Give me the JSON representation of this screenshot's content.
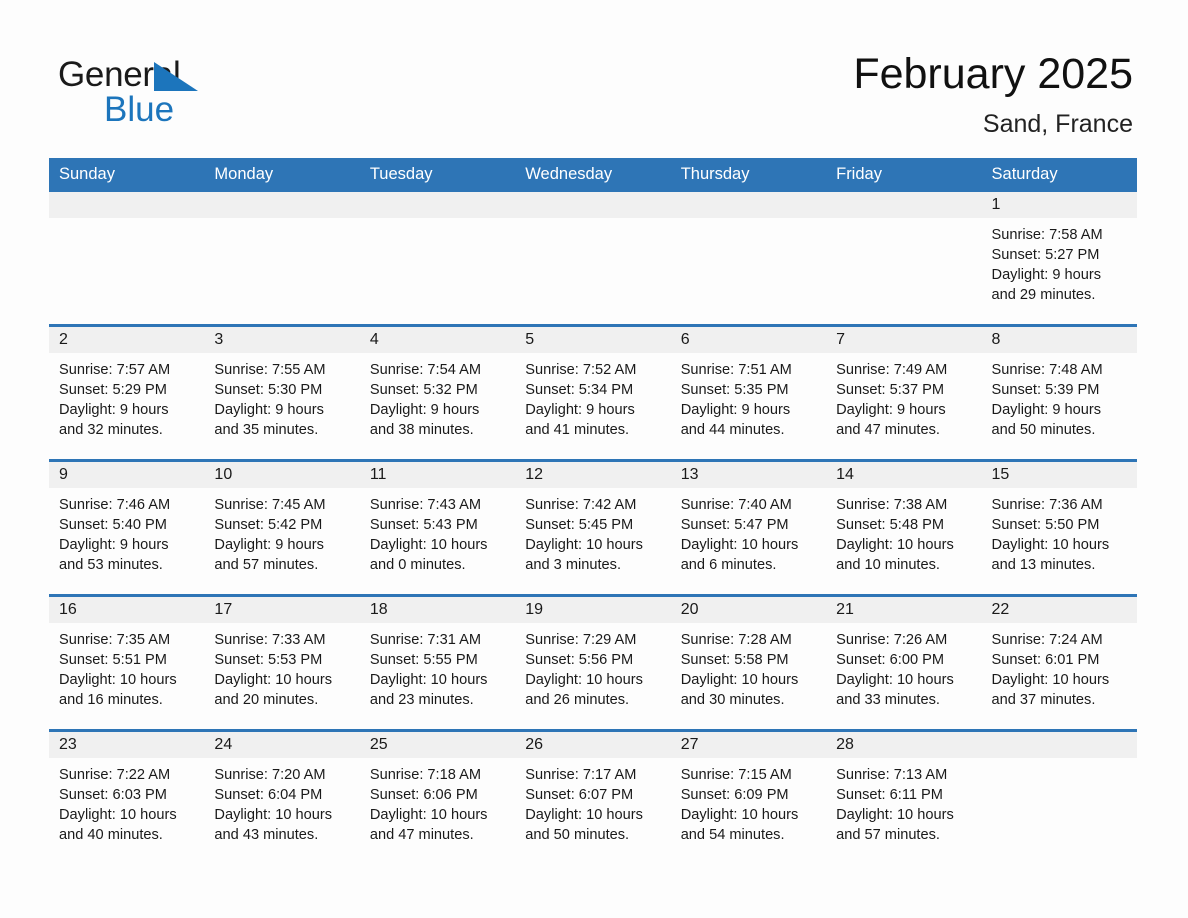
{
  "brand": {
    "name_part1": "General",
    "name_part2": "Blue",
    "logo_icon": "triangle-logo",
    "accent_color": "#1c75bc"
  },
  "header": {
    "title": "February 2025",
    "subtitle": "Sand, France"
  },
  "theme": {
    "header_blue": "#2e75b6",
    "cell_number_bg": "#f0f0f0",
    "page_bg": "#fdfdfd"
  },
  "weekday_headers": [
    "Sunday",
    "Monday",
    "Tuesday",
    "Wednesday",
    "Thursday",
    "Friday",
    "Saturday"
  ],
  "labels": {
    "sunrise_prefix": "Sunrise:",
    "sunset_prefix": "Sunset:",
    "daylight_prefix": "Daylight:"
  },
  "weeks": [
    [
      {
        "day": "",
        "empty": true
      },
      {
        "day": "",
        "empty": true
      },
      {
        "day": "",
        "empty": true
      },
      {
        "day": "",
        "empty": true
      },
      {
        "day": "",
        "empty": true
      },
      {
        "day": "",
        "empty": true
      },
      {
        "day": "1",
        "sunrise": "Sunrise: 7:58 AM",
        "sunset": "Sunset: 5:27 PM",
        "daylight1": "Daylight: 9 hours",
        "daylight2": "and 29 minutes."
      }
    ],
    [
      {
        "day": "2",
        "sunrise": "Sunrise: 7:57 AM",
        "sunset": "Sunset: 5:29 PM",
        "daylight1": "Daylight: 9 hours",
        "daylight2": "and 32 minutes."
      },
      {
        "day": "3",
        "sunrise": "Sunrise: 7:55 AM",
        "sunset": "Sunset: 5:30 PM",
        "daylight1": "Daylight: 9 hours",
        "daylight2": "and 35 minutes."
      },
      {
        "day": "4",
        "sunrise": "Sunrise: 7:54 AM",
        "sunset": "Sunset: 5:32 PM",
        "daylight1": "Daylight: 9 hours",
        "daylight2": "and 38 minutes."
      },
      {
        "day": "5",
        "sunrise": "Sunrise: 7:52 AM",
        "sunset": "Sunset: 5:34 PM",
        "daylight1": "Daylight: 9 hours",
        "daylight2": "and 41 minutes."
      },
      {
        "day": "6",
        "sunrise": "Sunrise: 7:51 AM",
        "sunset": "Sunset: 5:35 PM",
        "daylight1": "Daylight: 9 hours",
        "daylight2": "and 44 minutes."
      },
      {
        "day": "7",
        "sunrise": "Sunrise: 7:49 AM",
        "sunset": "Sunset: 5:37 PM",
        "daylight1": "Daylight: 9 hours",
        "daylight2": "and 47 minutes."
      },
      {
        "day": "8",
        "sunrise": "Sunrise: 7:48 AM",
        "sunset": "Sunset: 5:39 PM",
        "daylight1": "Daylight: 9 hours",
        "daylight2": "and 50 minutes."
      }
    ],
    [
      {
        "day": "9",
        "sunrise": "Sunrise: 7:46 AM",
        "sunset": "Sunset: 5:40 PM",
        "daylight1": "Daylight: 9 hours",
        "daylight2": "and 53 minutes."
      },
      {
        "day": "10",
        "sunrise": "Sunrise: 7:45 AM",
        "sunset": "Sunset: 5:42 PM",
        "daylight1": "Daylight: 9 hours",
        "daylight2": "and 57 minutes."
      },
      {
        "day": "11",
        "sunrise": "Sunrise: 7:43 AM",
        "sunset": "Sunset: 5:43 PM",
        "daylight1": "Daylight: 10 hours",
        "daylight2": "and 0 minutes."
      },
      {
        "day": "12",
        "sunrise": "Sunrise: 7:42 AM",
        "sunset": "Sunset: 5:45 PM",
        "daylight1": "Daylight: 10 hours",
        "daylight2": "and 3 minutes."
      },
      {
        "day": "13",
        "sunrise": "Sunrise: 7:40 AM",
        "sunset": "Sunset: 5:47 PM",
        "daylight1": "Daylight: 10 hours",
        "daylight2": "and 6 minutes."
      },
      {
        "day": "14",
        "sunrise": "Sunrise: 7:38 AM",
        "sunset": "Sunset: 5:48 PM",
        "daylight1": "Daylight: 10 hours",
        "daylight2": "and 10 minutes."
      },
      {
        "day": "15",
        "sunrise": "Sunrise: 7:36 AM",
        "sunset": "Sunset: 5:50 PM",
        "daylight1": "Daylight: 10 hours",
        "daylight2": "and 13 minutes."
      }
    ],
    [
      {
        "day": "16",
        "sunrise": "Sunrise: 7:35 AM",
        "sunset": "Sunset: 5:51 PM",
        "daylight1": "Daylight: 10 hours",
        "daylight2": "and 16 minutes."
      },
      {
        "day": "17",
        "sunrise": "Sunrise: 7:33 AM",
        "sunset": "Sunset: 5:53 PM",
        "daylight1": "Daylight: 10 hours",
        "daylight2": "and 20 minutes."
      },
      {
        "day": "18",
        "sunrise": "Sunrise: 7:31 AM",
        "sunset": "Sunset: 5:55 PM",
        "daylight1": "Daylight: 10 hours",
        "daylight2": "and 23 minutes."
      },
      {
        "day": "19",
        "sunrise": "Sunrise: 7:29 AM",
        "sunset": "Sunset: 5:56 PM",
        "daylight1": "Daylight: 10 hours",
        "daylight2": "and 26 minutes."
      },
      {
        "day": "20",
        "sunrise": "Sunrise: 7:28 AM",
        "sunset": "Sunset: 5:58 PM",
        "daylight1": "Daylight: 10 hours",
        "daylight2": "and 30 minutes."
      },
      {
        "day": "21",
        "sunrise": "Sunrise: 7:26 AM",
        "sunset": "Sunset: 6:00 PM",
        "daylight1": "Daylight: 10 hours",
        "daylight2": "and 33 minutes."
      },
      {
        "day": "22",
        "sunrise": "Sunrise: 7:24 AM",
        "sunset": "Sunset: 6:01 PM",
        "daylight1": "Daylight: 10 hours",
        "daylight2": "and 37 minutes."
      }
    ],
    [
      {
        "day": "23",
        "sunrise": "Sunrise: 7:22 AM",
        "sunset": "Sunset: 6:03 PM",
        "daylight1": "Daylight: 10 hours",
        "daylight2": "and 40 minutes."
      },
      {
        "day": "24",
        "sunrise": "Sunrise: 7:20 AM",
        "sunset": "Sunset: 6:04 PM",
        "daylight1": "Daylight: 10 hours",
        "daylight2": "and 43 minutes."
      },
      {
        "day": "25",
        "sunrise": "Sunrise: 7:18 AM",
        "sunset": "Sunset: 6:06 PM",
        "daylight1": "Daylight: 10 hours",
        "daylight2": "and 47 minutes."
      },
      {
        "day": "26",
        "sunrise": "Sunrise: 7:17 AM",
        "sunset": "Sunset: 6:07 PM",
        "daylight1": "Daylight: 10 hours",
        "daylight2": "and 50 minutes."
      },
      {
        "day": "27",
        "sunrise": "Sunrise: 7:15 AM",
        "sunset": "Sunset: 6:09 PM",
        "daylight1": "Daylight: 10 hours",
        "daylight2": "and 54 minutes."
      },
      {
        "day": "28",
        "sunrise": "Sunrise: 7:13 AM",
        "sunset": "Sunset: 6:11 PM",
        "daylight1": "Daylight: 10 hours",
        "daylight2": "and 57 minutes."
      },
      {
        "day": "",
        "empty": true
      }
    ]
  ]
}
